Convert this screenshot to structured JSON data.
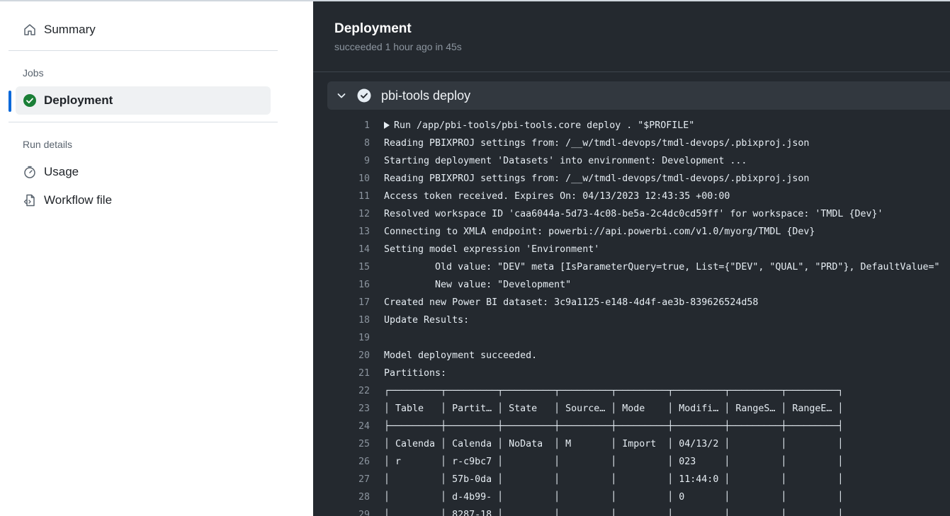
{
  "sidebar": {
    "summary_label": "Summary",
    "jobs_heading": "Jobs",
    "job_label": "Deployment",
    "run_details_heading": "Run details",
    "usage_label": "Usage",
    "workflow_file_label": "Workflow file"
  },
  "main": {
    "title": "Deployment",
    "subtitle": "succeeded 1 hour ago in 45s",
    "step_name": "pbi-tools deploy",
    "log": [
      {
        "n": "1",
        "text": "Run /app/pbi-tools/pbi-tools.core deploy . \"$PROFILE\"",
        "collapsed": true
      },
      {
        "n": "8",
        "text": "Reading PBIXPROJ settings from: /__w/tmdl-devops/tmdl-devops/.pbixproj.json"
      },
      {
        "n": "9",
        "text": "Starting deployment 'Datasets' into environment: Development ..."
      },
      {
        "n": "10",
        "text": "Reading PBIXPROJ settings from: /__w/tmdl-devops/tmdl-devops/.pbixproj.json"
      },
      {
        "n": "11",
        "text": "Access token received. Expires On: 04/13/2023 12:43:35 +00:00"
      },
      {
        "n": "12",
        "text": "Resolved workspace ID 'caa6044a-5d73-4c08-be5a-2c4dc0cd59ff' for workspace: 'TMDL {Dev}'"
      },
      {
        "n": "13",
        "text": "Connecting to XMLA endpoint: powerbi://api.powerbi.com/v1.0/myorg/TMDL {Dev}"
      },
      {
        "n": "14",
        "text": "Setting model expression 'Environment'"
      },
      {
        "n": "15",
        "text": "         Old value: \"DEV\" meta [IsParameterQuery=true, List={\"DEV\", \"QUAL\", \"PRD\"}, DefaultValue=\""
      },
      {
        "n": "16",
        "text": "         New value: \"Development\""
      },
      {
        "n": "17",
        "text": "Created new Power BI dataset: 3c9a1125-e148-4d4f-ae3b-839626524d58"
      },
      {
        "n": "18",
        "text": "Update Results:"
      },
      {
        "n": "19",
        "text": ""
      },
      {
        "n": "20",
        "text": "Model deployment succeeded."
      },
      {
        "n": "21",
        "text": "Partitions:"
      },
      {
        "n": "22",
        "text": "┌─────────┬─────────┬─────────┬─────────┬─────────┬─────────┬─────────┬─────────┐"
      },
      {
        "n": "23",
        "text": "│ Table   │ Partit… │ State   │ Source… │ Mode    │ Modifi… │ RangeS… │ RangeE… │"
      },
      {
        "n": "24",
        "text": "├─────────┼─────────┼─────────┼─────────┼─────────┼─────────┼─────────┼─────────┤"
      },
      {
        "n": "25",
        "text": "│ Calenda │ Calenda │ NoData  │ M       │ Import  │ 04/13/2 │         │         │"
      },
      {
        "n": "26",
        "text": "│ r       │ r-c9bc7 │         │         │         │ 023     │         │         │"
      },
      {
        "n": "27",
        "text": "│         │ 57b-0da │         │         │         │ 11:44:0 │         │         │"
      },
      {
        "n": "28",
        "text": "│         │ d-4b99- │         │         │         │ 0       │         │         │"
      },
      {
        "n": "29",
        "text": "│         │ 8287-18 │         │         │         │         │         │         │"
      }
    ]
  },
  "colors": {
    "accent": "#0969da",
    "success": "#1a7f37",
    "log_background": "#24292f"
  },
  "icons": {
    "summary": "home-icon",
    "job_status": "check-circle-icon",
    "usage": "stopwatch-icon",
    "workflow_file": "file-code-icon",
    "step_toggle": "chevron-down-icon",
    "step_status": "check-circle-icon"
  }
}
